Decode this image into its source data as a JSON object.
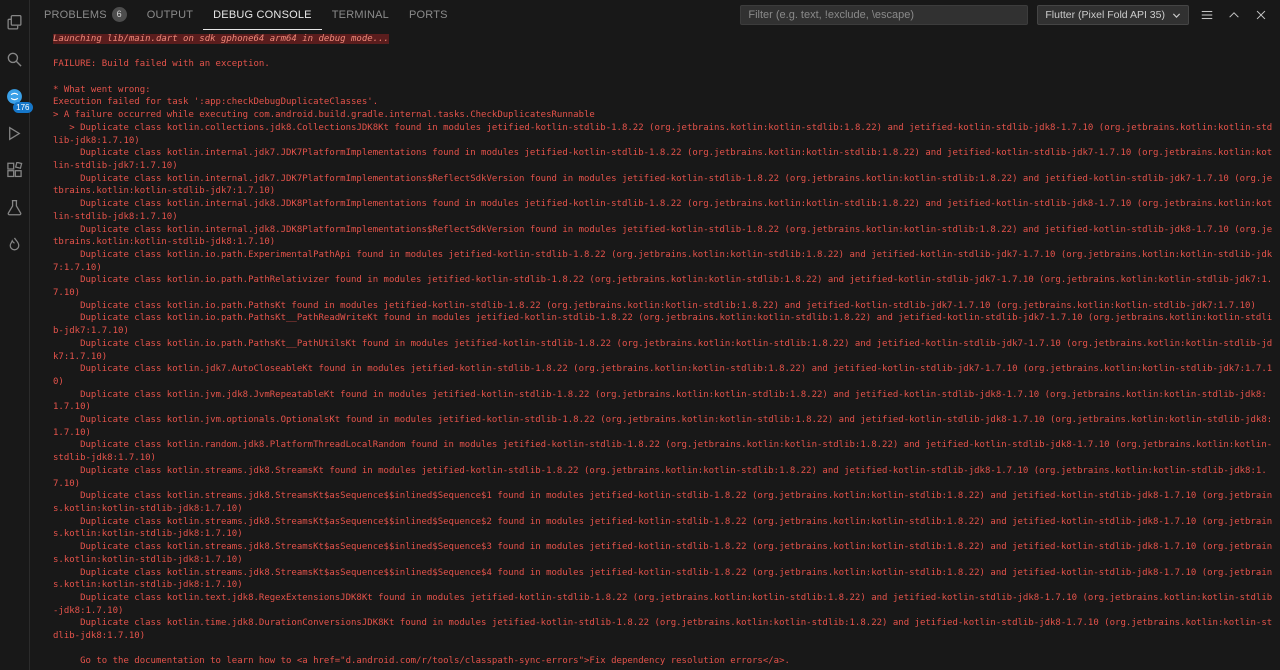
{
  "colors": {
    "background": "#181818",
    "error_text": "#e5534b",
    "highlight_bg": "#5a1d1d",
    "badge_blue": "#1677c9",
    "active_tab_underline": "#e7e7e7"
  },
  "activity_bar": {
    "icons": [
      "copy-files-icon",
      "search-icon",
      "chat-icon",
      "run-debug-icon",
      "extensions-icon",
      "testing-icon",
      "flame-icon"
    ],
    "chat_badge": "176"
  },
  "panel": {
    "tabs": [
      {
        "label": "PROBLEMS",
        "badge": "6",
        "active": false
      },
      {
        "label": "OUTPUT",
        "active": false
      },
      {
        "label": "DEBUG CONSOLE",
        "active": true
      },
      {
        "label": "TERMINAL",
        "active": false
      },
      {
        "label": "PORTS",
        "active": false
      }
    ],
    "filter_placeholder": "Filter (e.g. text, !exclude, \\escape)",
    "device_selector": "Flutter (Pixel Fold API 35)",
    "action_icons": [
      "panel-actions-icon",
      "maximize-panel-icon",
      "close-panel-icon"
    ]
  },
  "console": {
    "lines": [
      {
        "text": "Launching lib/main.dart on sdk gphone64 arm64 in debug mode...",
        "highlight": true
      },
      {
        "text": ""
      },
      {
        "text": "FAILURE: Build failed with an exception."
      },
      {
        "text": ""
      },
      {
        "text": "* What went wrong:"
      },
      {
        "text": "Execution failed for task ':app:checkDebugDuplicateClasses'."
      },
      {
        "text": "> A failure occurred while executing com.android.build.gradle.internal.tasks.CheckDuplicatesRunnable"
      },
      {
        "text": "   > Duplicate class kotlin.collections.jdk8.CollectionsJDK8Kt found in modules jetified-kotlin-stdlib-1.8.22 (org.jetbrains.kotlin:kotlin-stdlib:1.8.22) and jetified-kotlin-stdlib-jdk8-1.7.10 (org.jetbrains.kotlin:kotlin-stdlib-jdk8:1.7.10)"
      },
      {
        "text": "     Duplicate class kotlin.internal.jdk7.JDK7PlatformImplementations found in modules jetified-kotlin-stdlib-1.8.22 (org.jetbrains.kotlin:kotlin-stdlib:1.8.22) and jetified-kotlin-stdlib-jdk7-1.7.10 (org.jetbrains.kotlin:kotlin-stdlib-jdk7:1.7.10)"
      },
      {
        "text": "     Duplicate class kotlin.internal.jdk7.JDK7PlatformImplementations$ReflectSdkVersion found in modules jetified-kotlin-stdlib-1.8.22 (org.jetbrains.kotlin:kotlin-stdlib:1.8.22) and jetified-kotlin-stdlib-jdk7-1.7.10 (org.jetbrains.kotlin:kotlin-stdlib-jdk7:1.7.10)"
      },
      {
        "text": "     Duplicate class kotlin.internal.jdk8.JDK8PlatformImplementations found in modules jetified-kotlin-stdlib-1.8.22 (org.jetbrains.kotlin:kotlin-stdlib:1.8.22) and jetified-kotlin-stdlib-jdk8-1.7.10 (org.jetbrains.kotlin:kotlin-stdlib-jdk8:1.7.10)"
      },
      {
        "text": "     Duplicate class kotlin.internal.jdk8.JDK8PlatformImplementations$ReflectSdkVersion found in modules jetified-kotlin-stdlib-1.8.22 (org.jetbrains.kotlin:kotlin-stdlib:1.8.22) and jetified-kotlin-stdlib-jdk8-1.7.10 (org.jetbrains.kotlin:kotlin-stdlib-jdk8:1.7.10)"
      },
      {
        "text": "     Duplicate class kotlin.io.path.ExperimentalPathApi found in modules jetified-kotlin-stdlib-1.8.22 (org.jetbrains.kotlin:kotlin-stdlib:1.8.22) and jetified-kotlin-stdlib-jdk7-1.7.10 (org.jetbrains.kotlin:kotlin-stdlib-jdk7:1.7.10)"
      },
      {
        "text": "     Duplicate class kotlin.io.path.PathRelativizer found in modules jetified-kotlin-stdlib-1.8.22 (org.jetbrains.kotlin:kotlin-stdlib:1.8.22) and jetified-kotlin-stdlib-jdk7-1.7.10 (org.jetbrains.kotlin:kotlin-stdlib-jdk7:1.7.10)"
      },
      {
        "text": "     Duplicate class kotlin.io.path.PathsKt found in modules jetified-kotlin-stdlib-1.8.22 (org.jetbrains.kotlin:kotlin-stdlib:1.8.22) and jetified-kotlin-stdlib-jdk7-1.7.10 (org.jetbrains.kotlin:kotlin-stdlib-jdk7:1.7.10)"
      },
      {
        "text": "     Duplicate class kotlin.io.path.PathsKt__PathReadWriteKt found in modules jetified-kotlin-stdlib-1.8.22 (org.jetbrains.kotlin:kotlin-stdlib:1.8.22) and jetified-kotlin-stdlib-jdk7-1.7.10 (org.jetbrains.kotlin:kotlin-stdlib-jdk7:1.7.10)"
      },
      {
        "text": "     Duplicate class kotlin.io.path.PathsKt__PathUtilsKt found in modules jetified-kotlin-stdlib-1.8.22 (org.jetbrains.kotlin:kotlin-stdlib:1.8.22) and jetified-kotlin-stdlib-jdk7-1.7.10 (org.jetbrains.kotlin:kotlin-stdlib-jdk7:1.7.10)"
      },
      {
        "text": "     Duplicate class kotlin.jdk7.AutoCloseableKt found in modules jetified-kotlin-stdlib-1.8.22 (org.jetbrains.kotlin:kotlin-stdlib:1.8.22) and jetified-kotlin-stdlib-jdk7-1.7.10 (org.jetbrains.kotlin:kotlin-stdlib-jdk7:1.7.10)"
      },
      {
        "text": "     Duplicate class kotlin.jvm.jdk8.JvmRepeatableKt found in modules jetified-kotlin-stdlib-1.8.22 (org.jetbrains.kotlin:kotlin-stdlib:1.8.22) and jetified-kotlin-stdlib-jdk8-1.7.10 (org.jetbrains.kotlin:kotlin-stdlib-jdk8:1.7.10)"
      },
      {
        "text": "     Duplicate class kotlin.jvm.optionals.OptionalsKt found in modules jetified-kotlin-stdlib-1.8.22 (org.jetbrains.kotlin:kotlin-stdlib:1.8.22) and jetified-kotlin-stdlib-jdk8-1.7.10 (org.jetbrains.kotlin:kotlin-stdlib-jdk8:1.7.10)"
      },
      {
        "text": "     Duplicate class kotlin.random.jdk8.PlatformThreadLocalRandom found in modules jetified-kotlin-stdlib-1.8.22 (org.jetbrains.kotlin:kotlin-stdlib:1.8.22) and jetified-kotlin-stdlib-jdk8-1.7.10 (org.jetbrains.kotlin:kotlin-stdlib-jdk8:1.7.10)"
      },
      {
        "text": "     Duplicate class kotlin.streams.jdk8.StreamsKt found in modules jetified-kotlin-stdlib-1.8.22 (org.jetbrains.kotlin:kotlin-stdlib:1.8.22) and jetified-kotlin-stdlib-jdk8-1.7.10 (org.jetbrains.kotlin:kotlin-stdlib-jdk8:1.7.10)"
      },
      {
        "text": "     Duplicate class kotlin.streams.jdk8.StreamsKt$asSequence$$inlined$Sequence$1 found in modules jetified-kotlin-stdlib-1.8.22 (org.jetbrains.kotlin:kotlin-stdlib:1.8.22) and jetified-kotlin-stdlib-jdk8-1.7.10 (org.jetbrains.kotlin:kotlin-stdlib-jdk8:1.7.10)"
      },
      {
        "text": "     Duplicate class kotlin.streams.jdk8.StreamsKt$asSequence$$inlined$Sequence$2 found in modules jetified-kotlin-stdlib-1.8.22 (org.jetbrains.kotlin:kotlin-stdlib:1.8.22) and jetified-kotlin-stdlib-jdk8-1.7.10 (org.jetbrains.kotlin:kotlin-stdlib-jdk8:1.7.10)"
      },
      {
        "text": "     Duplicate class kotlin.streams.jdk8.StreamsKt$asSequence$$inlined$Sequence$3 found in modules jetified-kotlin-stdlib-1.8.22 (org.jetbrains.kotlin:kotlin-stdlib:1.8.22) and jetified-kotlin-stdlib-jdk8-1.7.10 (org.jetbrains.kotlin:kotlin-stdlib-jdk8:1.7.10)"
      },
      {
        "text": "     Duplicate class kotlin.streams.jdk8.StreamsKt$asSequence$$inlined$Sequence$4 found in modules jetified-kotlin-stdlib-1.8.22 (org.jetbrains.kotlin:kotlin-stdlib:1.8.22) and jetified-kotlin-stdlib-jdk8-1.7.10 (org.jetbrains.kotlin:kotlin-stdlib-jdk8:1.7.10)"
      },
      {
        "text": "     Duplicate class kotlin.text.jdk8.RegexExtensionsJDK8Kt found in modules jetified-kotlin-stdlib-1.8.22 (org.jetbrains.kotlin:kotlin-stdlib:1.8.22) and jetified-kotlin-stdlib-jdk8-1.7.10 (org.jetbrains.kotlin:kotlin-stdlib-jdk8:1.7.10)"
      },
      {
        "text": "     Duplicate class kotlin.time.jdk8.DurationConversionsJDK8Kt found in modules jetified-kotlin-stdlib-1.8.22 (org.jetbrains.kotlin:kotlin-stdlib:1.8.22) and jetified-kotlin-stdlib-jdk8-1.7.10 (org.jetbrains.kotlin:kotlin-stdlib-jdk8:1.7.10)"
      },
      {
        "text": ""
      },
      {
        "text": "     Go to the documentation to learn how to <a href=\"d.android.com/r/tools/classpath-sync-errors\">Fix dependency resolution errors</a>."
      }
    ]
  }
}
